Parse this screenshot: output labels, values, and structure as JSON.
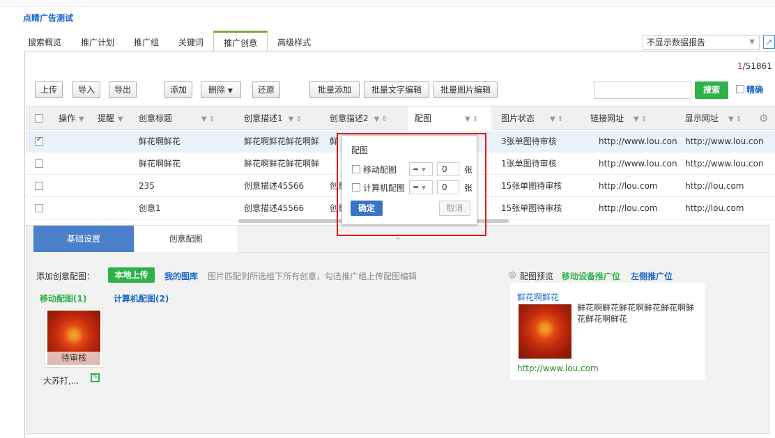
{
  "app_title": "点睛广告测试",
  "tabs": [
    "搜索概览",
    "推广计划",
    "推广组",
    "关键词",
    "推广创意",
    "高级样式"
  ],
  "active_tab": "推广创意",
  "report_select": "不显示数据报告",
  "pager": {
    "current": "1",
    "total": "/51861"
  },
  "toolbar": {
    "upload": "上传",
    "import": "导入",
    "export": "导出",
    "add": "添加",
    "delete": "删除",
    "restore": "还原",
    "batch_add": "批量添加",
    "batch_text_edit": "批量文字编辑",
    "batch_image_edit": "批量图片编辑",
    "search": "搜索",
    "exact": "精确"
  },
  "columns": {
    "op": "操作",
    "remind": "提醒",
    "title": "创意标题",
    "desc1": "创意描述1",
    "desc2": "创意描述2",
    "image": "配图",
    "img_status": "图片状态",
    "link_url": "链接网址",
    "display_url": "显示网址"
  },
  "rows": [
    {
      "title": "鲜花啊鲜花",
      "desc1": "鲜花啊鲜花鲜花啊鲜",
      "desc2": "鲜",
      "img_status": "3张单图待审核",
      "link_url": "http://www.lou.con",
      "display_url": "http://www.lou.con",
      "checked": true
    },
    {
      "title": "鲜花啊鲜花",
      "desc1": "鲜花啊鲜花鲜花啊鲜",
      "desc2": "",
      "img_status": "1张单图待审核",
      "link_url": "http://www.lou.con",
      "display_url": "http://www.lou.con",
      "checked": false
    },
    {
      "title": "235",
      "desc1": "创意描述45566",
      "desc2": "创意",
      "img_status": "15张单图待审核",
      "link_url": "http://lou.com",
      "display_url": "http://lou.com",
      "checked": false
    },
    {
      "title": "创意1",
      "desc1": "创意描述45566",
      "desc2": "创意",
      "img_status": "15张单图待审核",
      "link_url": "http://lou.com",
      "display_url": "http://lou.com",
      "checked": false
    }
  ],
  "filter_popup": {
    "title": "配图",
    "mobile_label": "移动配图",
    "pc_label": "计算机配图",
    "op": "=",
    "mobile_value": "0",
    "pc_value": "0",
    "unit": "张",
    "confirm": "确定",
    "cancel": "取消"
  },
  "bottom": {
    "tab_basic": "基础设置",
    "tab_image": "创意配图",
    "add_label": "添加创意配图：",
    "local_upload": "本地上传",
    "my_gallery": "我的图库",
    "hint": "图片匹配到所选组下所有创意，勾选推广组上传配图编辑",
    "mobile_count": "移动配图(1)",
    "pc_count": "计算机配图(2)",
    "pending": "待审核",
    "thumb_name": "大苏打,...",
    "preview_label": "配图预览",
    "preview_mobile": "移动设备推广位",
    "preview_left": "左侧推广位",
    "preview_title": "鲜花啊鲜花",
    "preview_desc": "鲜花啊鲜花鲜花啊鲜花鲜花啊鲜花鲜花啊鲜花",
    "preview_url": "http://www.lou.com"
  }
}
